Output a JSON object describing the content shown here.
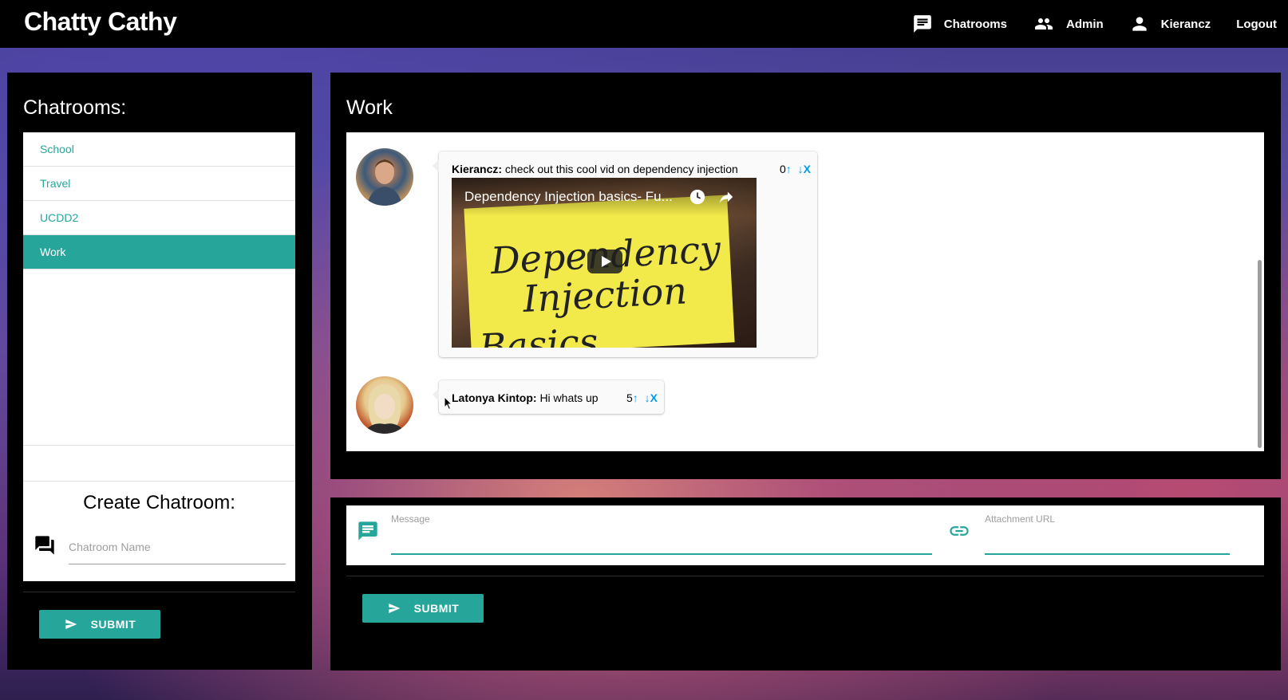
{
  "navbar": {
    "brand": "Chatty Cathy",
    "items": [
      {
        "label": "Chatrooms",
        "icon": "chat-icon"
      },
      {
        "label": "Admin",
        "icon": "people-icon"
      },
      {
        "label": "Kierancz",
        "icon": "person-icon"
      },
      {
        "label": "Logout"
      }
    ]
  },
  "sidebar": {
    "title": "Chatrooms:",
    "rooms": [
      {
        "label": "School",
        "active": false
      },
      {
        "label": "Travel",
        "active": false
      },
      {
        "label": "UCDD2",
        "active": false
      },
      {
        "label": "Work",
        "active": true
      }
    ],
    "create": {
      "title": "Create Chatroom:",
      "placeholder": "Chatroom Name",
      "icon": "forum-icon",
      "submit_label": "SUBMIT"
    }
  },
  "chat": {
    "title": "Work",
    "messages": [
      {
        "author": "Kierancz:",
        "text": "check out this cool vid on dependency injection",
        "votes": "0",
        "up": "↑",
        "down": "↓",
        "delete": "X",
        "video": {
          "title": "Dependency Injection basics- Fu...",
          "sign_lines": [
            "Dependency",
            "Injection",
            "Basics"
          ]
        }
      },
      {
        "author": "Latonya Kintop:",
        "text": "Hi whats up",
        "votes": "5",
        "up": "↑",
        "down": "↓",
        "delete": "X"
      }
    ]
  },
  "compose": {
    "message_label": "Message",
    "attachment_label": "Attachment URL",
    "submit_label": "SUBMIT"
  },
  "colors": {
    "accent": "#26a69a",
    "link": "#039be5",
    "navbar": "#000000"
  }
}
